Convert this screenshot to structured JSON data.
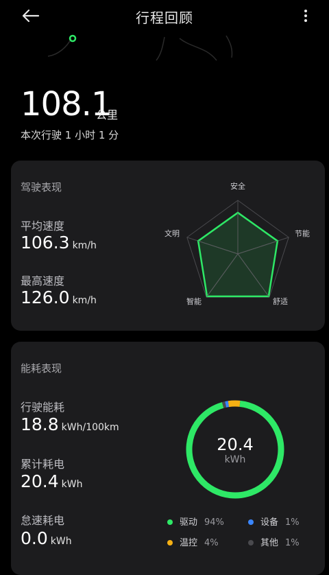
{
  "header": {
    "title": "行程回顾",
    "back_icon": "back-arrow-icon",
    "more_icon": "more-vertical-icon"
  },
  "summary": {
    "distance": "108.1",
    "distance_unit": "公里",
    "duration": "本次行驶 1 小时 1 分"
  },
  "driving_card": {
    "title": "驾驶表现",
    "avg_speed_label": "平均速度",
    "avg_speed_value": "106.3",
    "avg_speed_unit": "km/h",
    "max_speed_label": "最高速度",
    "max_speed_value": "126.0",
    "max_speed_unit": "km/h",
    "radar": {
      "labels": [
        "安全",
        "节能",
        "舒适",
        "智能",
        "文明"
      ],
      "scores": [
        0.77,
        0.78,
        0.98,
        0.98,
        0.78
      ]
    }
  },
  "energy_card": {
    "title": "能耗表现",
    "consumption_label": "行驶能耗",
    "consumption_value": "18.8",
    "consumption_unit": "kWh/100km",
    "total_label": "累计耗电",
    "total_value": "20.4",
    "total_unit": "kWh",
    "idle_label": "怠速耗电",
    "idle_value": "0.0",
    "idle_unit": "kWh",
    "donut": {
      "value": "20.4",
      "unit": "kWh"
    },
    "legend": [
      {
        "name": "驱动",
        "pct": "94%",
        "color": "#2ee866"
      },
      {
        "name": "设备",
        "pct": "1%",
        "color": "#3a86ff"
      },
      {
        "name": "温控",
        "pct": "4%",
        "color": "#f5b014"
      },
      {
        "name": "其他",
        "pct": "1%",
        "color": "#4a4a4e"
      }
    ]
  },
  "colors": {
    "accent": "#2ee866",
    "background": "#000000",
    "card": "#1c1c1e"
  }
}
